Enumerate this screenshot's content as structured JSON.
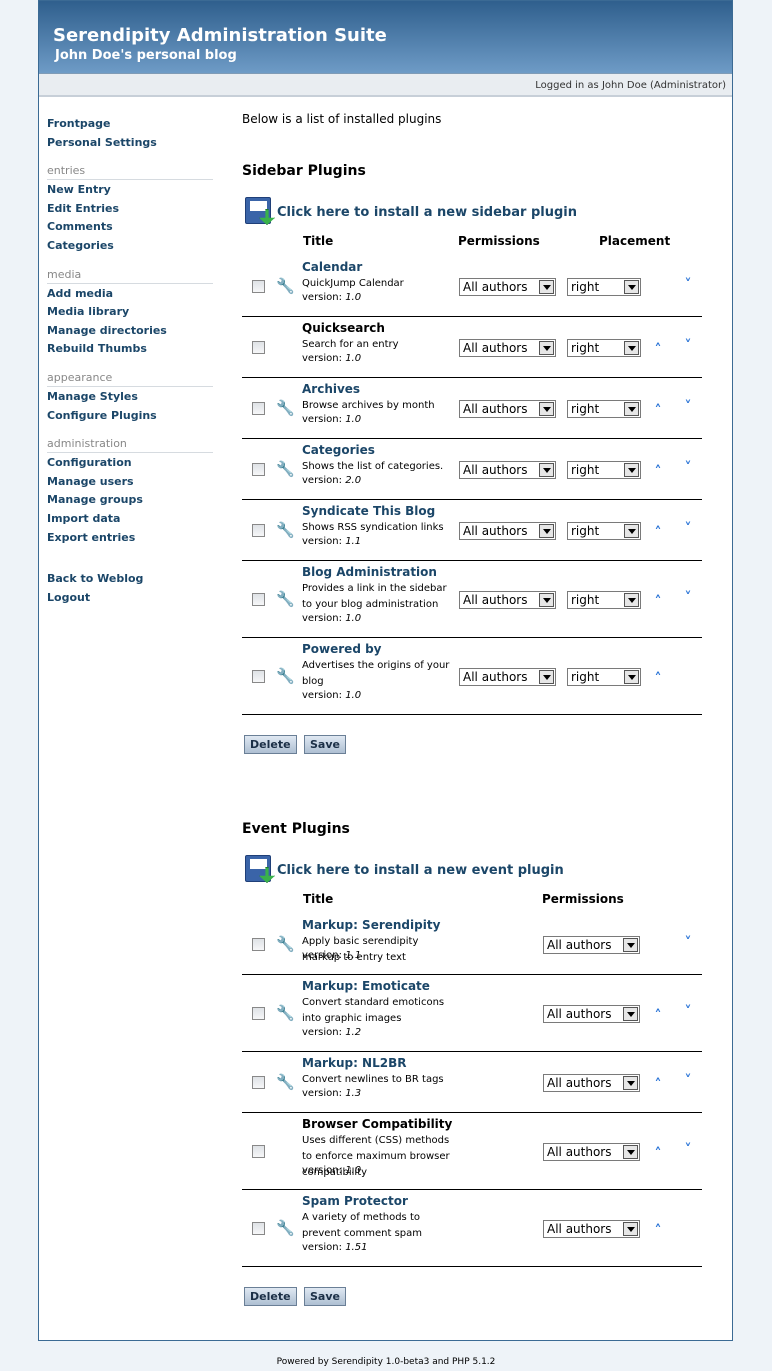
{
  "header": {
    "title": "Serendipity Administration Suite",
    "subtitle": "John Doe's personal blog",
    "status": "Logged in as John Doe (Administrator)"
  },
  "sidebar": {
    "top": [
      "Frontpage",
      "Personal Settings"
    ],
    "groups": [
      {
        "heading": "entries",
        "items": [
          "New Entry",
          "Edit Entries",
          "Comments",
          "Categories"
        ]
      },
      {
        "heading": "media",
        "items": [
          "Add media",
          "Media library",
          "Manage directories",
          "Rebuild Thumbs"
        ]
      },
      {
        "heading": "appearance",
        "items": [
          "Manage Styles",
          "Configure Plugins"
        ]
      },
      {
        "heading": "administration",
        "items": [
          "Configuration",
          "Manage users",
          "Manage groups",
          "Import data",
          "Export entries"
        ]
      }
    ],
    "bottom": [
      "Back to Weblog",
      "Logout"
    ]
  },
  "main": {
    "intro": "Below is a list of installed plugins",
    "sidebar_plugins": {
      "title": "Sidebar Plugins",
      "install": "Click here to install a new sidebar plugin",
      "col_title": "Title",
      "col_permissions": "Permissions",
      "col_placement": "Placement",
      "plugins": [
        {
          "title": "Calendar",
          "desc": "QuickJump Calendar",
          "version_label": "version:",
          "version": "1.0",
          "perm": "All authors",
          "place": "right"
        },
        {
          "title": "Quicksearch",
          "desc": "Search for an entry",
          "version_label": "version:",
          "version": "1.0",
          "perm": "All authors",
          "place": "right"
        },
        {
          "title": "Archives",
          "desc": "Browse archives by month",
          "version_label": "version:",
          "version": "1.0",
          "perm": "All authors",
          "place": "right"
        },
        {
          "title": "Categories",
          "desc": "Shows the list of categories.",
          "version_label": "version:",
          "version": "2.0",
          "perm": "All authors",
          "place": "right"
        },
        {
          "title": "Syndicate This Blog",
          "desc": "Shows RSS syndication links",
          "version_label": "version:",
          "version": "1.1",
          "perm": "All authors",
          "place": "right"
        },
        {
          "title": "Blog Administration",
          "desc": "Provides a link in the sidebar to your blog administration",
          "version_label": "version:",
          "version": "1.0",
          "perm": "All authors",
          "place": "right"
        },
        {
          "title": "Powered by",
          "desc": "Advertises the origins of your blog",
          "version_label": "version:",
          "version": "1.0",
          "perm": "All authors",
          "place": "right"
        }
      ],
      "delete": "Delete",
      "save": "Save"
    },
    "event_plugins": {
      "title": "Event Plugins",
      "install": "Click here to install a new event plugin",
      "col_title": "Title",
      "col_permissions": "Permissions",
      "plugins": [
        {
          "title": "Markup: Serendipity",
          "desc": "Apply basic serendipity markup to entry text",
          "version_label": "version:",
          "version": "1.1",
          "perm": "All authors"
        },
        {
          "title": "Markup: Emoticate",
          "desc": "Convert standard emoticons into graphic images",
          "version_label": "version:",
          "version": "1.2",
          "perm": "All authors"
        },
        {
          "title": "Markup: NL2BR",
          "desc": "Convert newlines to BR tags",
          "version_label": "version:",
          "version": "1.3",
          "perm": "All authors"
        },
        {
          "title": "Browser Compatibility",
          "desc": "Uses different (CSS) methods to enforce maximum browser compatibility",
          "version_label": "version:",
          "version": "1.0",
          "perm": "All authors"
        },
        {
          "title": "Spam Protector",
          "desc": "A variety of methods to prevent comment spam",
          "version_label": "version:",
          "version": "1.51",
          "perm": "All authors"
        }
      ],
      "delete": "Delete",
      "save": "Save"
    }
  },
  "footer": "Powered by Serendipity 1.0-beta3 and PHP 5.1.2",
  "icons": {
    "wrench": "wrench-icon",
    "up": "arrow-up-icon",
    "down": "arrow-down-icon",
    "install": "install-plugin-icon"
  },
  "colors": {
    "header_top": "#2f5f8d",
    "header_bottom": "#6e9bc6",
    "link": "#1b4668",
    "arrow": "#2b74d6"
  }
}
